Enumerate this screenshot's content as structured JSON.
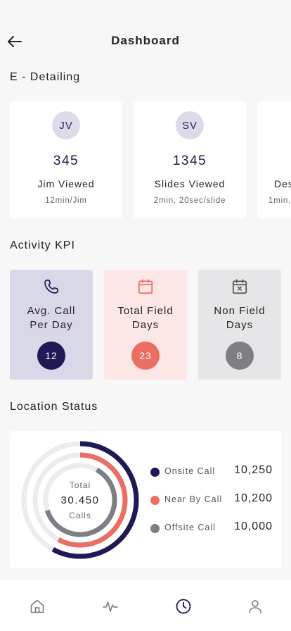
{
  "header": {
    "title": "Dashboard",
    "back_icon": "arrow-left-icon"
  },
  "e_detailing": {
    "title": "E - Detailing",
    "cards": [
      {
        "initials": "JV",
        "value": "345",
        "label": "Jim Viewed",
        "sub": "12min/Jim"
      },
      {
        "initials": "SV",
        "value": "1345",
        "label": "Slides Viewed",
        "sub": "2min, 20sec/slide"
      },
      {
        "initials": "",
        "value": "",
        "label": "Des",
        "sub": "1min,"
      }
    ]
  },
  "activity_kpi": {
    "title": "Activity KPI",
    "cards": [
      {
        "label_line1": "Avg. Call",
        "label_line2": "Per Day",
        "value": "12",
        "icon": "phone-icon",
        "bg": "#d9d8e8",
        "badge": "#1e1a55",
        "icon_color": "#1e1a55"
      },
      {
        "label_line1": "Total Field",
        "label_line2": "Days",
        "value": "23",
        "icon": "calendar-icon",
        "bg": "#fde6e6",
        "badge": "#ea6e63",
        "icon_color": "#ea6e63"
      },
      {
        "label_line1": "Non Field",
        "label_line2": "Days",
        "value": "8",
        "icon": "calendar-x-icon",
        "bg": "#e6e6e8",
        "badge": "#7d7f85",
        "icon_color": "#555"
      }
    ]
  },
  "location_status": {
    "title": "Location Status",
    "center_top": "Total",
    "center_value": "30.450",
    "center_bottom": "Calls",
    "legend": [
      {
        "label": "Onsite Call",
        "value": "10,250",
        "color": "#1e1a55"
      },
      {
        "label": "Near By Call",
        "value": "10,200",
        "color": "#ea6e63"
      },
      {
        "label": "Offsite Call",
        "value": "10,000",
        "color": "#7d7f85"
      }
    ]
  },
  "chart_data": {
    "type": "donut",
    "title": "Total Calls",
    "series": [
      {
        "name": "Onsite Call",
        "value": 10250,
        "fraction": 0.58
      },
      {
        "name": "Near By Call",
        "value": 10200,
        "fraction": 0.58
      },
      {
        "name": "Offsite Call",
        "value": 10000,
        "fraction": 0.62
      }
    ]
  },
  "bottom_nav": {
    "items": [
      {
        "icon": "home-icon"
      },
      {
        "icon": "activity-icon"
      },
      {
        "icon": "clock-icon",
        "active": true
      },
      {
        "icon": "user-icon"
      }
    ]
  }
}
